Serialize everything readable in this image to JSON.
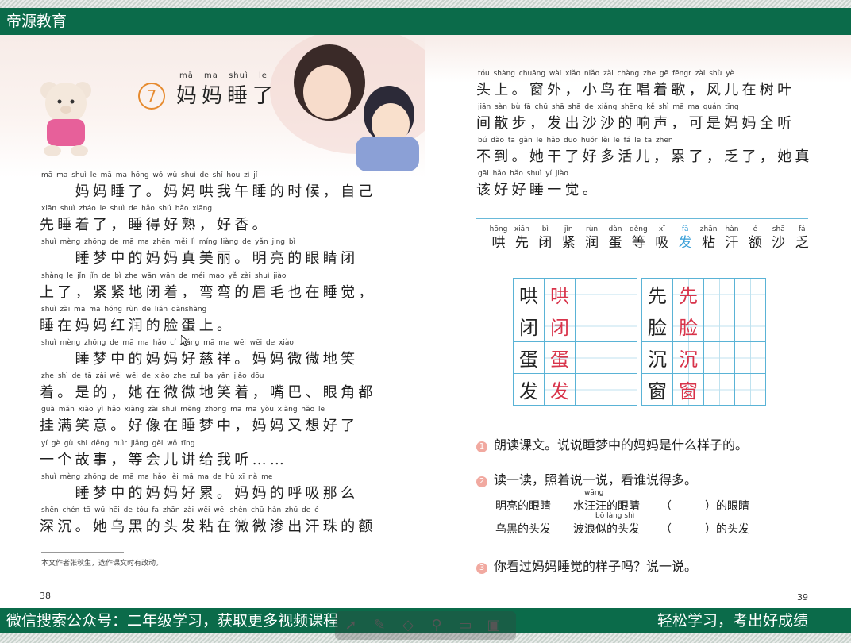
{
  "header": {
    "brand": "帝源教育"
  },
  "footer": {
    "left": "微信搜索公众号：二年级学习，获取更多视频课程",
    "right": "轻松学习，考出好成绩"
  },
  "left_page": {
    "lesson_number": "7",
    "title": "妈妈睡了",
    "title_pinyin": "mā ma shuì le",
    "lines": [
      {
        "py": "mā ma shuì le    mā ma hōng wǒ wǔ shuì de shí hou    zì jǐ",
        "hz": "　　妈妈睡了。妈妈哄我午睡的时候，自己"
      },
      {
        "py": "xiān shuì zháo le    shuì de hǎo shú    hǎo xiāng",
        "hz": "先睡着了，睡得好熟，好香。"
      },
      {
        "py": "shuì mèng zhōng de mā ma zhēn měi lì    míng liàng de yǎn jing bì",
        "hz": "　　睡梦中的妈妈真美丽。明亮的眼睛闭"
      },
      {
        "py": "shàng le    jǐn jǐn de bì zhe    wān wān de méi mao yě zài shuì jiào",
        "hz": "上了，紧紧地闭着，弯弯的眉毛也在睡觉，"
      },
      {
        "py": "shuì zài mā ma hóng rùn de liǎn dànshàng",
        "hz": "睡在妈妈红润的脸蛋上。"
      },
      {
        "py": "shuì mèng zhōng de mā ma hǎo cí xiáng    mā ma wēi wēi de xiào",
        "hz": "　　睡梦中的妈妈好慈祥。妈妈微微地笑"
      },
      {
        "py": "zhe    shì de    tā zài wēi wēi de xiào zhe    zuǐ ba    yǎn jiǎo dōu",
        "hz": "着。是的，她在微微地笑着，嘴巴、眼角都"
      },
      {
        "py": "guà mǎn xiào yì    hǎo xiàng zài shuì mèng zhōng    mā ma yòu xiǎng hǎo le",
        "hz": "挂满笑意。好像在睡梦中，妈妈又想好了"
      },
      {
        "py": "yí gè gù shi    děng huìr    jiǎng gěi wǒ tīng",
        "hz": "一个故事，等会儿讲给我听……"
      },
      {
        "py": "shuì mèng zhōng de mā ma hǎo lèi    mā ma de hū xī nà me",
        "hz": "　　睡梦中的妈妈好累。妈妈的呼吸那么"
      },
      {
        "py": "shēn chén    tā wū hēi de tóu fa zhān zài wēi wēi shèn chū hàn zhū de é",
        "hz": "深沉。她乌黑的头发粘在微微渗出汗珠的额"
      }
    ],
    "footnote": "本文作者张秋生，选作课文时有改动。",
    "page_number": "38"
  },
  "right_page": {
    "lines": [
      {
        "py": "tóu shàng    chuāng wài    xiǎo niǎo zài chàng zhe gē    fēngr zài shù yè",
        "hz": "头上。窗外，小鸟在唱着歌，风儿在树叶"
      },
      {
        "py": "jiān sàn bù    fā chū shā shā de xiǎng shēng    kě shì mā ma quán tīng",
        "hz": "间散步，发出沙沙的响声，可是妈妈全听"
      },
      {
        "py": "bú dào    tā gàn le hǎo duō huór    lèi le    fá le    tā zhēn",
        "hz": "不到。她干了好多活儿，累了，乏了，她真"
      },
      {
        "py": "gāi hǎo hǎo shuì yí jiào",
        "hz": "该好好睡一觉。"
      }
    ],
    "words": [
      {
        "py": "hōng",
        "hz": "哄"
      },
      {
        "py": "xiān",
        "hz": "先"
      },
      {
        "py": "bì",
        "hz": "闭"
      },
      {
        "py": "jǐn",
        "hz": "紧"
      },
      {
        "py": "rùn",
        "hz": "润"
      },
      {
        "py": "dàn",
        "hz": "蛋"
      },
      {
        "py": "děng",
        "hz": "等"
      },
      {
        "py": "xī",
        "hz": "吸"
      },
      {
        "py": "fā",
        "hz": "发"
      },
      {
        "py": "zhān",
        "hz": "粘"
      },
      {
        "py": "hàn",
        "hz": "汗"
      },
      {
        "py": "é",
        "hz": "额"
      },
      {
        "py": "shā",
        "hz": "沙"
      },
      {
        "py": "fá",
        "hz": "乏"
      }
    ],
    "writing_grid": {
      "left": [
        [
          "哄",
          "哄"
        ],
        [
          "闭",
          "闭"
        ],
        [
          "蛋",
          "蛋"
        ],
        [
          "发",
          "发"
        ]
      ],
      "right": [
        [
          "先",
          "先"
        ],
        [
          "脸",
          "脸"
        ],
        [
          "沉",
          "沉"
        ],
        [
          "窗",
          "窗"
        ]
      ]
    },
    "exercises": {
      "q1": "朗读课文。说说睡梦中的妈妈是什么样子的。",
      "q2": "读一读，照着说一说，看谁说得多。",
      "row1": {
        "a": "明亮的眼睛",
        "b": "水汪汪的眼睛",
        "py": "wāng",
        "c": "（　　　）的眼睛"
      },
      "row2": {
        "a": "乌黑的头发",
        "b": "波浪似的头发",
        "py": "bō làng shì",
        "c": "（　　　）的头发"
      },
      "q3": "你看过妈妈睡觉的样子吗？说一说。"
    },
    "page_number": "39"
  },
  "colors": {
    "header_green": "#0b6b4a",
    "accent_red": "#d8334a",
    "grid_blue": "#5ab3d6",
    "title_orange": "#e68a2e"
  },
  "toolbar_icons": [
    "pointer-icon",
    "pen-icon",
    "eraser-icon",
    "search-icon",
    "screen-icon",
    "window-icon"
  ]
}
